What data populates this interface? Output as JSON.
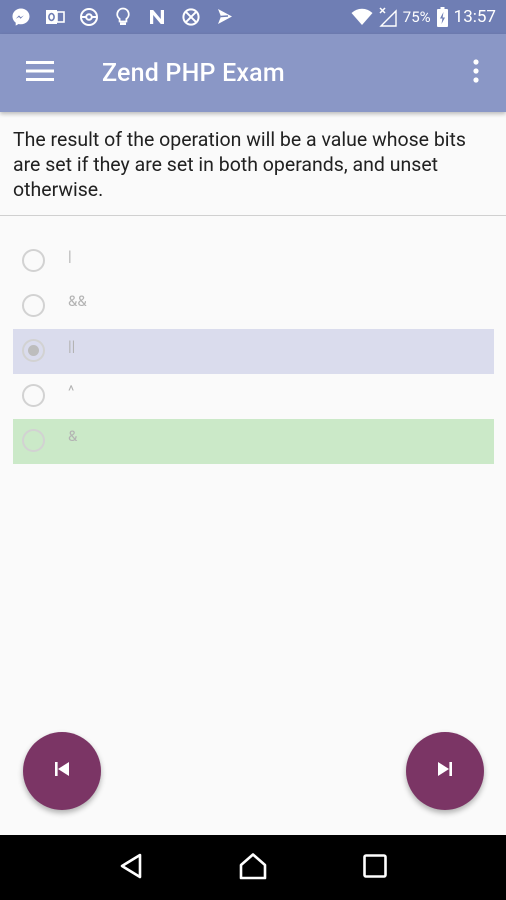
{
  "status_bar": {
    "battery": "75%",
    "time": "13:57",
    "notification_icons": [
      "messenger-icon",
      "outlook-icon",
      "pokeball-icon",
      "lightbulb-icon",
      "n-app-icon",
      "blocked-icon",
      "tap-icon"
    ],
    "bg_color": "#6f7eb4"
  },
  "app_bar": {
    "title": "Zend PHP Exam",
    "bg_color": "#8a97c6"
  },
  "question": {
    "text": "The result of the operation will be a value whose bits are set if they are set in both operands, and unset otherwise."
  },
  "options": [
    {
      "label": "|",
      "state": "default"
    },
    {
      "label": "&&",
      "state": "default"
    },
    {
      "label": "||",
      "state": "selected"
    },
    {
      "label": "^",
      "state": "default"
    },
    {
      "label": "&",
      "state": "correct"
    }
  ],
  "colors": {
    "selected_bg": "#dadced",
    "correct_bg": "#cbe9c8",
    "fab": "#7b3565"
  },
  "navigation": {
    "prev_icon": "skip-previous-icon",
    "next_icon": "skip-next-icon"
  }
}
